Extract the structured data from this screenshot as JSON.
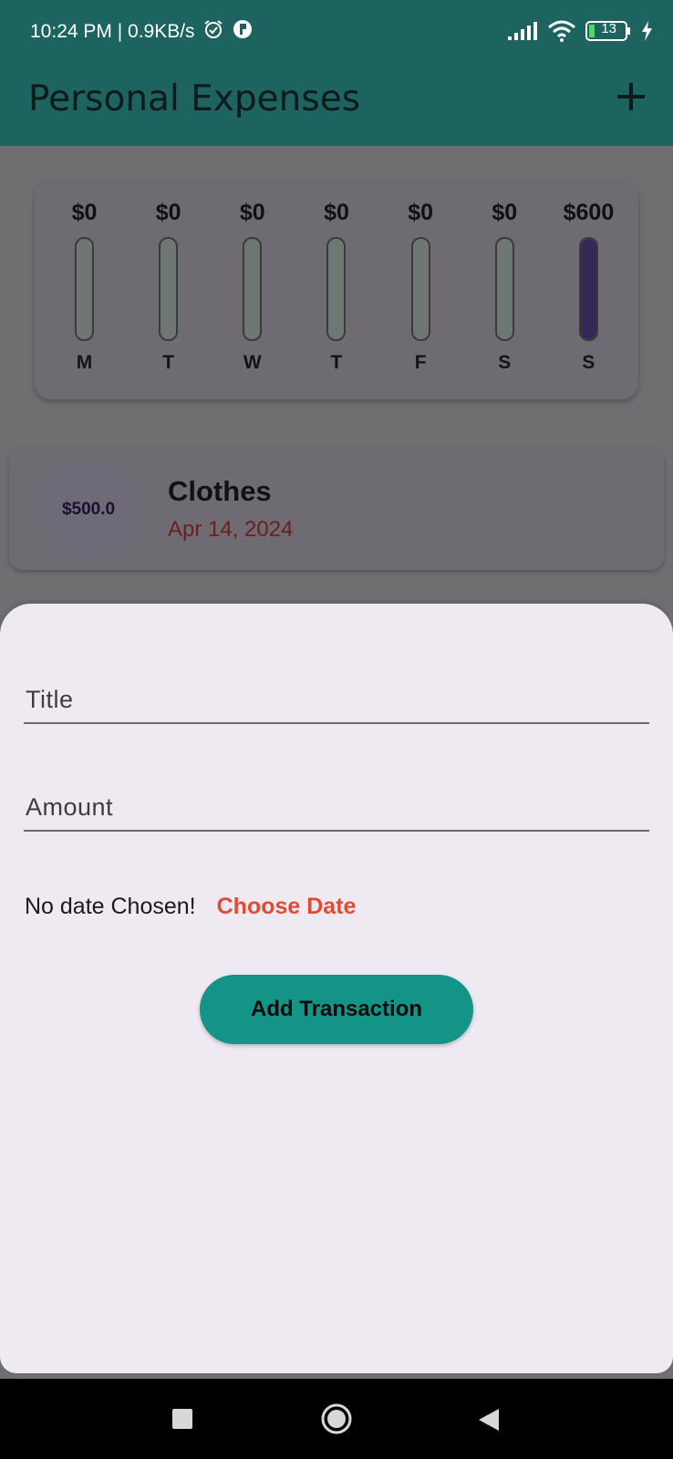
{
  "status_bar": {
    "time_speed": "10:24 PM | 0.9KB/s",
    "battery": "13"
  },
  "app_bar": {
    "title": "Personal Expenses",
    "add_icon": "plus-icon"
  },
  "chart": {
    "bars": [
      {
        "day": "M",
        "amount": "$0",
        "fill": 0
      },
      {
        "day": "T",
        "amount": "$0",
        "fill": 0
      },
      {
        "day": "W",
        "amount": "$0",
        "fill": 0
      },
      {
        "day": "T",
        "amount": "$0",
        "fill": 0
      },
      {
        "day": "F",
        "amount": "$0",
        "fill": 0
      },
      {
        "day": "S",
        "amount": "$0",
        "fill": 0
      },
      {
        "day": "S",
        "amount": "$600",
        "fill": 1
      }
    ]
  },
  "transactions": [
    {
      "amount": "$500.0",
      "title": "Clothes",
      "date": "Apr 14, 2024"
    }
  ],
  "form": {
    "title_label": "Title",
    "amount_label": "Amount",
    "date_status": "No date Chosen!",
    "choose_date": "Choose Date",
    "submit": "Add Transaction"
  },
  "colors": {
    "primary": "#1d6360",
    "button": "#149487",
    "accent": "#e14b33",
    "bar_fill": "#35295a"
  }
}
